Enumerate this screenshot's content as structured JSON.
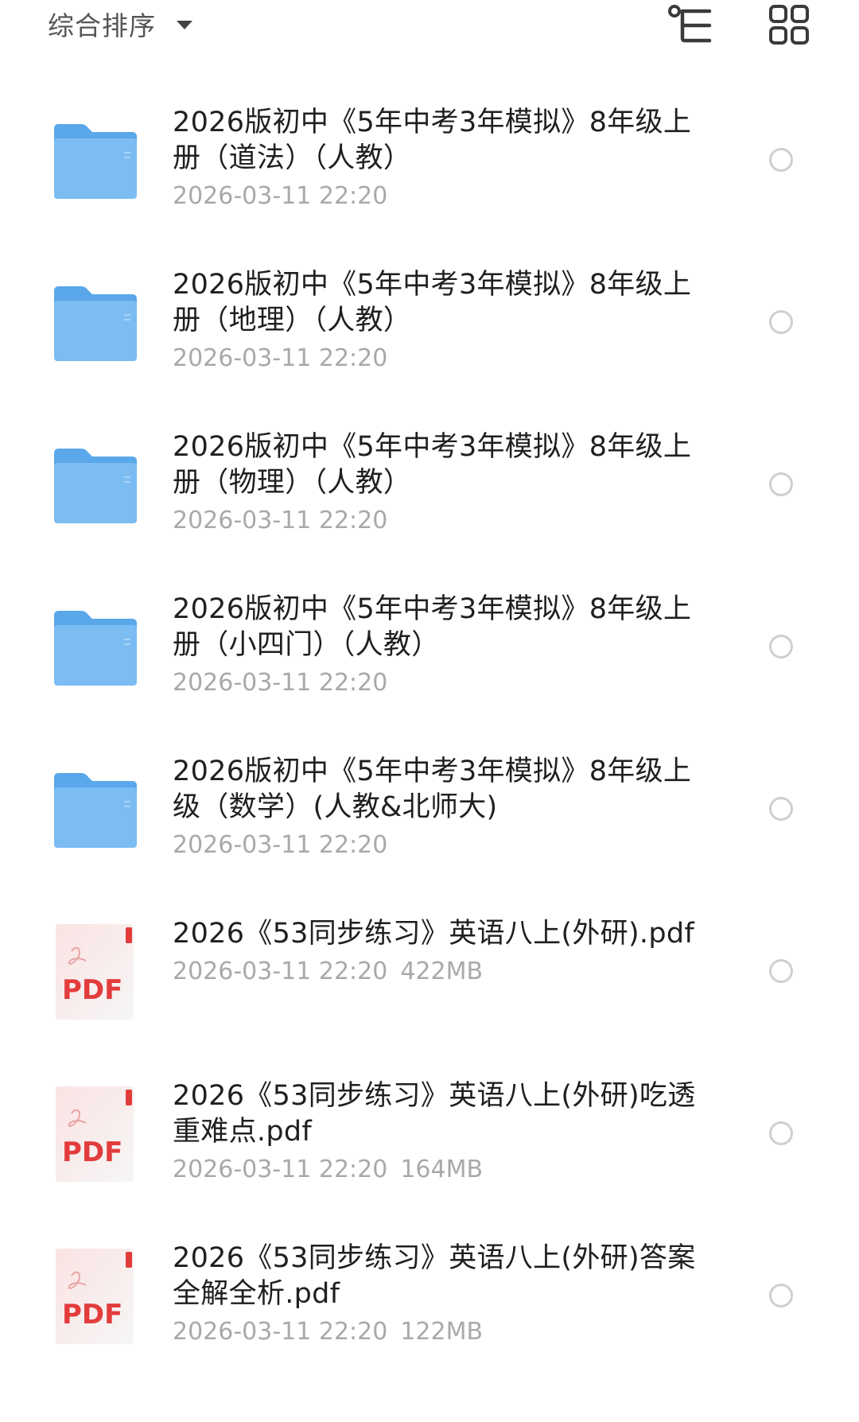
{
  "toolbar": {
    "sort_label": "综合排序",
    "icons": [
      "caret-down-icon",
      "tree-view-icon",
      "grid-view-icon"
    ]
  },
  "colors": {
    "folder_body": "#7bbcf3",
    "folder_back": "#5aa7ea",
    "pdf_red": "#e23c3c",
    "meta_gray": "#a9a9a9",
    "radio_border": "#cfcfcf"
  },
  "files": [
    {
      "type": "folder",
      "icon": "folder-icon",
      "name": "2026版初中《5年中考3年模拟》8年级上册（道法）（人教）",
      "date": "2026-03-11 22:20",
      "size": ""
    },
    {
      "type": "folder",
      "icon": "folder-icon",
      "name": "2026版初中《5年中考3年模拟》8年级上册（地理）（人教）",
      "date": "2026-03-11 22:20",
      "size": ""
    },
    {
      "type": "folder",
      "icon": "folder-icon",
      "name": "2026版初中《5年中考3年模拟》8年级上册（物理）（人教）",
      "date": "2026-03-11 22:20",
      "size": ""
    },
    {
      "type": "folder",
      "icon": "folder-icon",
      "name": "2026版初中《5年中考3年模拟》8年级上册（小四门）（人教）",
      "date": "2026-03-11 22:20",
      "size": ""
    },
    {
      "type": "folder",
      "icon": "folder-icon",
      "name": "2026版初中《5年中考3年模拟》8年级上级（数学）(人教&北师大)",
      "date": "2026-03-11 22:20",
      "size": ""
    },
    {
      "type": "pdf",
      "icon": "pdf-file-icon",
      "badge": "PDF",
      "name": "2026《53同步练习》英语八上(外研).pdf",
      "date": "2026-03-11 22:20",
      "size": "422MB"
    },
    {
      "type": "pdf",
      "icon": "pdf-file-icon",
      "badge": "PDF",
      "name": "2026《53同步练习》英语八上(外研)吃透重难点.pdf",
      "date": "2026-03-11 22:20",
      "size": "164MB"
    },
    {
      "type": "pdf",
      "icon": "pdf-file-icon",
      "badge": "PDF",
      "name": "2026《53同步练习》英语八上(外研)答案全解全析.pdf",
      "date": "2026-03-11 22:20",
      "size": "122MB"
    }
  ]
}
